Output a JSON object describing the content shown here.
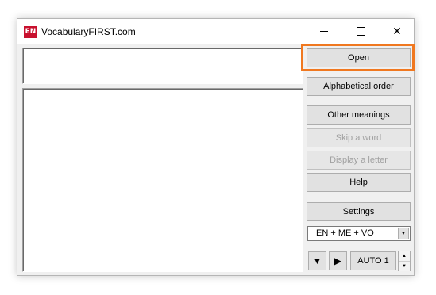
{
  "window": {
    "title": "VocabularyFIRST.com",
    "icon_text": "EN",
    "icon_name": "app-icon",
    "close_symbol": "✕"
  },
  "buttons": {
    "open": "Open",
    "alphabetical": "Alphabetical order",
    "other_meanings": "Other meanings",
    "skip_word": "Skip a word",
    "display_letter": "Display a letter",
    "help": "Help",
    "settings": "Settings",
    "auto": "AUTO 1",
    "down_symbol": "▼",
    "play_symbol": "▶"
  },
  "language_select": {
    "value": "EN  +  ME  +  VO",
    "arrow": "▼"
  },
  "spinner": {
    "up": "▲",
    "down": "▼"
  },
  "colors": {
    "highlight": "#f07820",
    "icon_bg": "#c8102e",
    "window_bg": "#f0f0f0"
  }
}
